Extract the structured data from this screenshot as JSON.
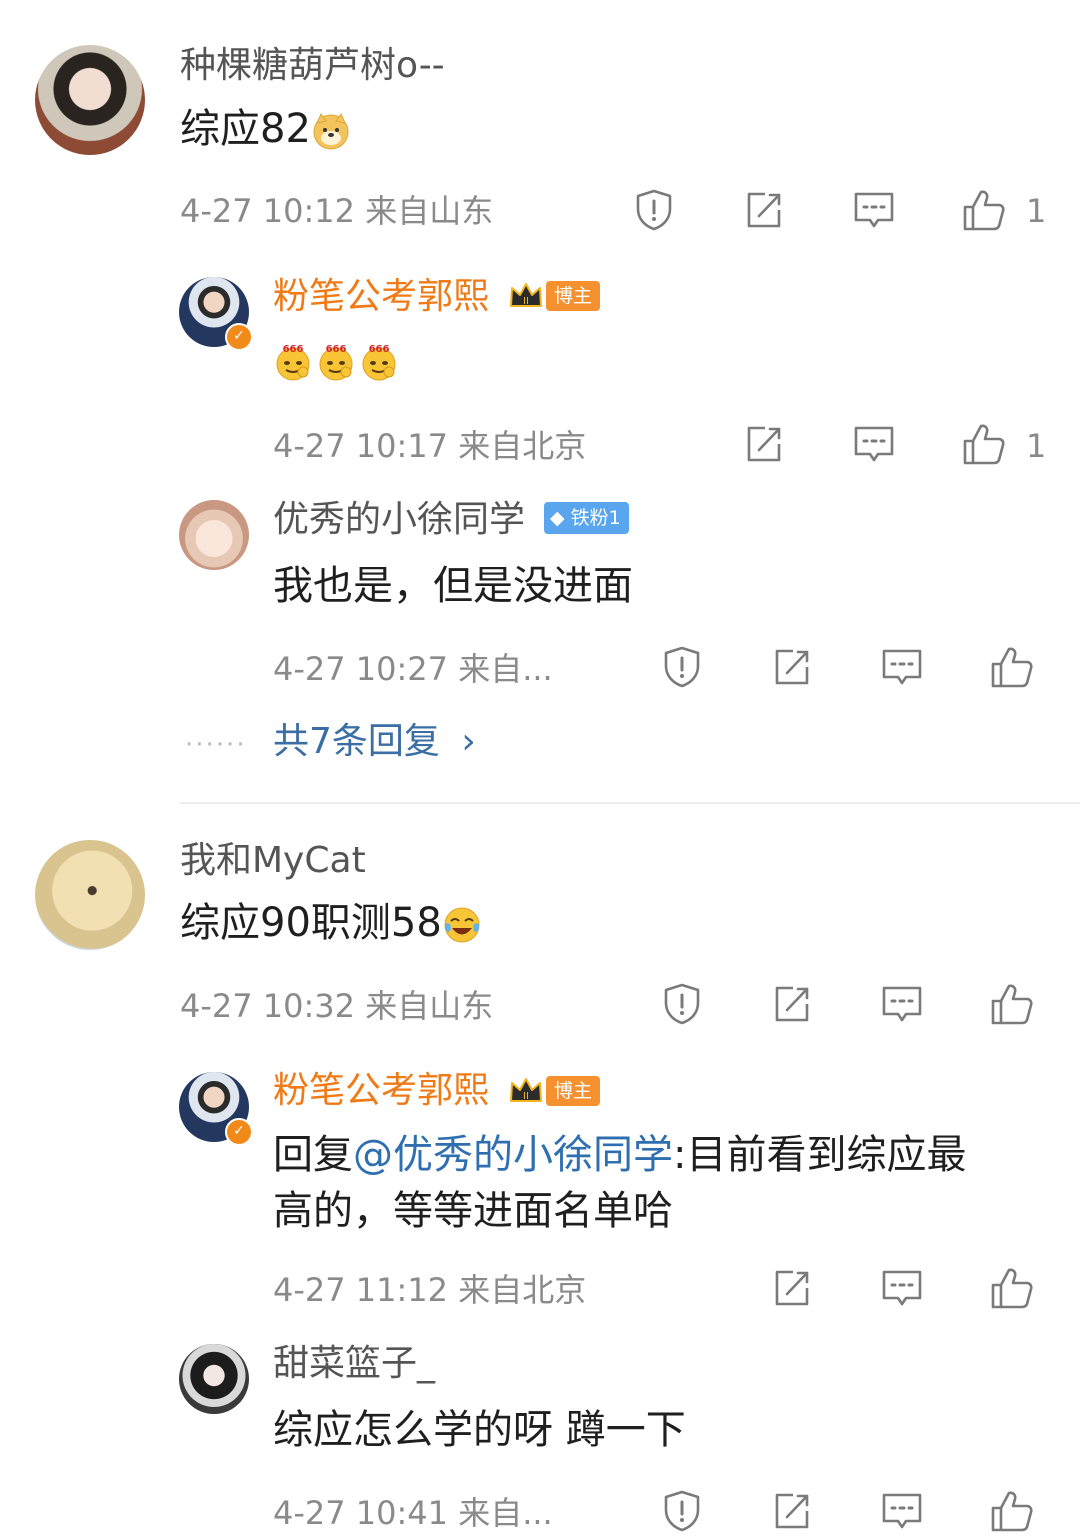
{
  "comments": [
    {
      "username": "种棵糖葫芦树o--",
      "text": "综应82",
      "emoji": "doge-emoji",
      "time": "4-27 10:12",
      "location": "来自山东",
      "like_count": "1",
      "replies": [
        {
          "username": "粉笔公考郭熙",
          "badge": "博主",
          "emojis": [
            "666-emoji",
            "666-emoji",
            "666-emoji"
          ],
          "time": "4-27 10:17",
          "location": "来自北京",
          "like_count": "1"
        },
        {
          "username": "优秀的小徐同学",
          "badge": "铁粉1",
          "text": "我也是，但是没进面",
          "time": "4-27 10:27",
          "location": "来自..."
        }
      ],
      "more_replies": "共7条回复",
      "more_dots": "······"
    },
    {
      "username": "我和MyCat",
      "text": "综应90职测58",
      "emoji": "laugh-cry-emoji",
      "time": "4-27 10:32",
      "location": "来自山东",
      "replies": [
        {
          "username": "粉笔公考郭熙",
          "badge": "博主",
          "reply_prefix": "回复",
          "mention": "@优秀的小徐同学",
          "text_line1_suffix": ":目前看到综应最",
          "text_line2": "高的，等等进面名单哈",
          "time": "4-27 11:12",
          "location": "来自北京"
        },
        {
          "username": "甜菜篮子_",
          "text": "综应怎么学的呀 蹲一下",
          "time": "4-27 10:41",
          "location": "来自..."
        }
      ]
    }
  ],
  "colors": {
    "vip_name": "#f07a16",
    "mention": "#2f6fb0",
    "replies_link": "#3b6ea5",
    "badge_bozhu": "#f5922f",
    "badge_tiefen": "#5aa6ee"
  }
}
